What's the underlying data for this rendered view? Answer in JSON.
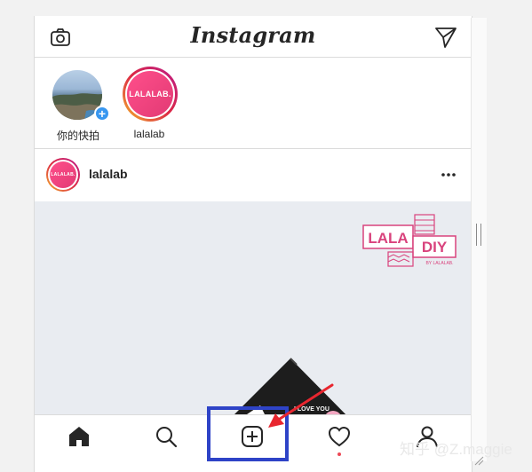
{
  "app": {
    "logo_text": "Instagram"
  },
  "topbar": {
    "left_icon": "camera-icon",
    "right_icon": "send-icon"
  },
  "stories": [
    {
      "label": "你的快拍",
      "avatar": "own-story-photo",
      "badge": "+"
    },
    {
      "label": "lalalab",
      "avatar_text": "LALALAB."
    }
  ],
  "post": {
    "username": "lalalab",
    "avatar_text": "LALALAB.",
    "more_icon": "more-icon",
    "image": {
      "brand_top": "LALA",
      "brand_right": "DIY",
      "brand_small": "BY LALALAB.",
      "product_text": "I LOVE YOU"
    }
  },
  "bottom_nav": [
    {
      "name": "home",
      "icon": "home-icon"
    },
    {
      "name": "search",
      "icon": "search-icon"
    },
    {
      "name": "new-post",
      "icon": "plus-square-icon"
    },
    {
      "name": "activity",
      "icon": "heart-icon"
    },
    {
      "name": "profile",
      "icon": "user-icon"
    }
  ],
  "annotation": {
    "highlight_color": "#2e43c7",
    "arrow_color": "#e8262f"
  },
  "watermark": "知乎 @Z.maggie",
  "colors": {
    "accent_blue": "#3897f0",
    "brand_pink": "#e23a74",
    "notification": "#ed4956"
  }
}
